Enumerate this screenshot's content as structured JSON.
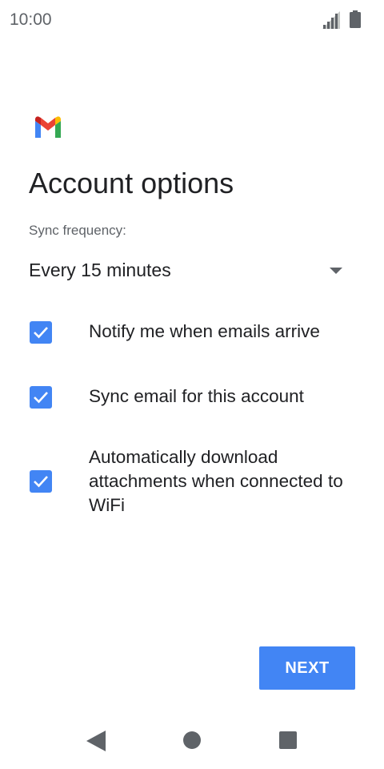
{
  "status_bar": {
    "time": "10:00",
    "icons": [
      "signal-icon",
      "battery-icon"
    ]
  },
  "header": {
    "logo_icon": "gmail-logo",
    "title": "Account options"
  },
  "sync": {
    "label": "Sync frequency:",
    "selected_value": "Every 15 minutes"
  },
  "options": [
    {
      "label": "Notify me when emails arrive",
      "checked": true
    },
    {
      "label": "Sync email for this account",
      "checked": true
    },
    {
      "label": "Automatically download attachments when connected to WiFi",
      "checked": true
    }
  ],
  "actions": {
    "next_label": "NEXT"
  },
  "nav_bar": {
    "icons": [
      "back-icon",
      "home-icon",
      "recents-icon"
    ]
  },
  "colors": {
    "accent": "#4285f4",
    "text_primary": "#202124",
    "text_secondary": "#5f6368",
    "background": "#ffffff"
  }
}
